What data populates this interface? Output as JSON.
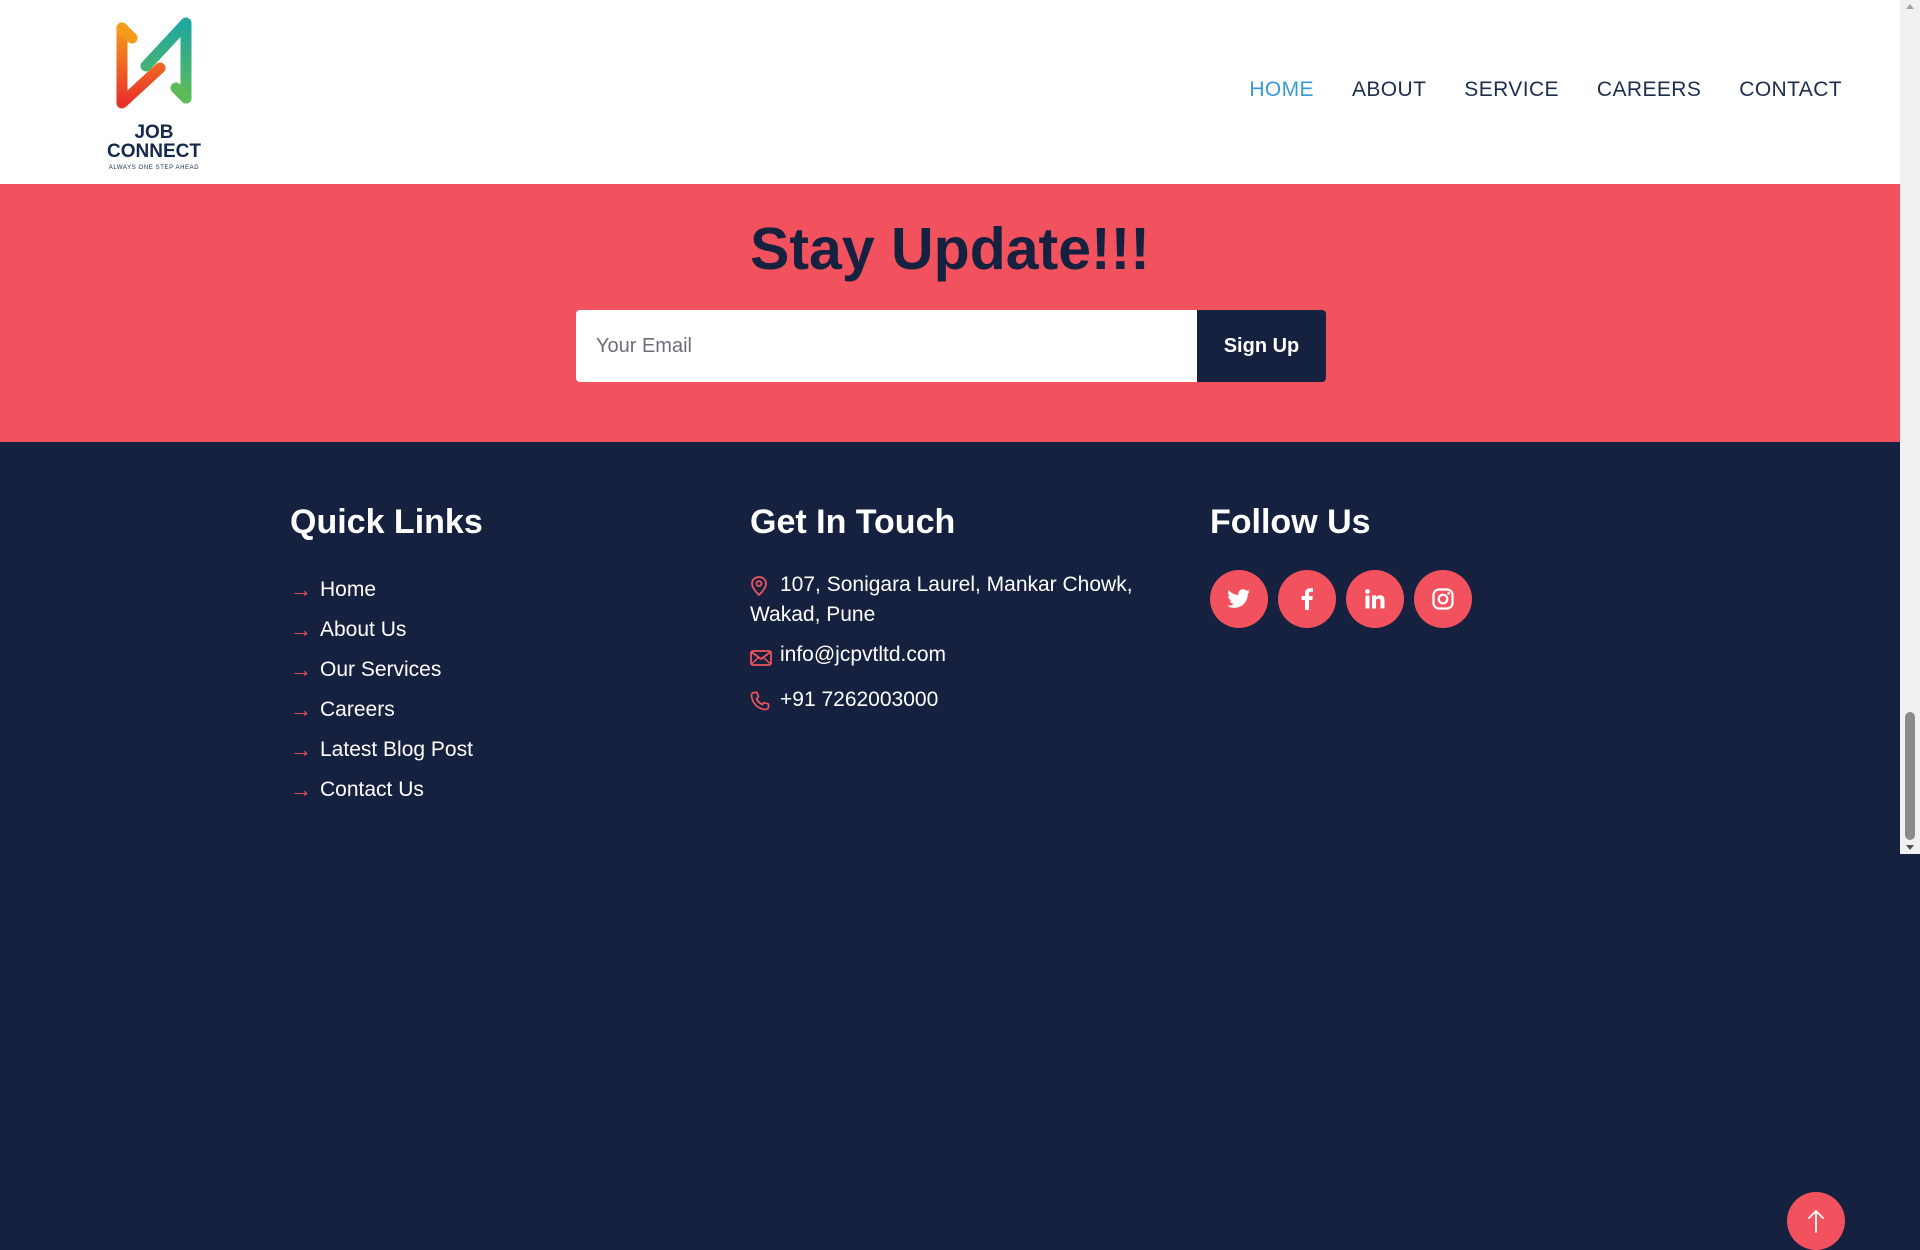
{
  "brand": {
    "line1": "JOB",
    "line2": "CONNECT",
    "tagline": "ALWAYS ONE STEP AHEAD"
  },
  "nav": {
    "items": [
      {
        "label": "HOME",
        "active": true
      },
      {
        "label": "ABOUT"
      },
      {
        "label": "SERVICE"
      },
      {
        "label": "CAREERS"
      },
      {
        "label": "CONTACT"
      }
    ]
  },
  "newsletter": {
    "title": "Stay Update!!!",
    "email_placeholder": "Your Email",
    "button_label": "Sign Up"
  },
  "footer": {
    "quick_links": {
      "title": "Quick Links",
      "items": [
        "Home",
        "About Us",
        "Our Services",
        "Careers",
        "Latest Blog Post",
        "Contact Us"
      ]
    },
    "contact": {
      "title": "Get In Touch",
      "address_line1": "107, Sonigara Laurel, Mankar Chowk,",
      "address_line2": "Wakad, Pune",
      "email": "info@jcpvtltd.com",
      "phone": "+91 7262003000"
    },
    "follow": {
      "title": "Follow Us",
      "networks": [
        "twitter-icon",
        "facebook-icon",
        "linkedin-icon",
        "instagram-icon"
      ]
    }
  },
  "colors": {
    "accent": "#f2525d",
    "navy": "#15213f",
    "nav_active": "#3a9ad9"
  }
}
